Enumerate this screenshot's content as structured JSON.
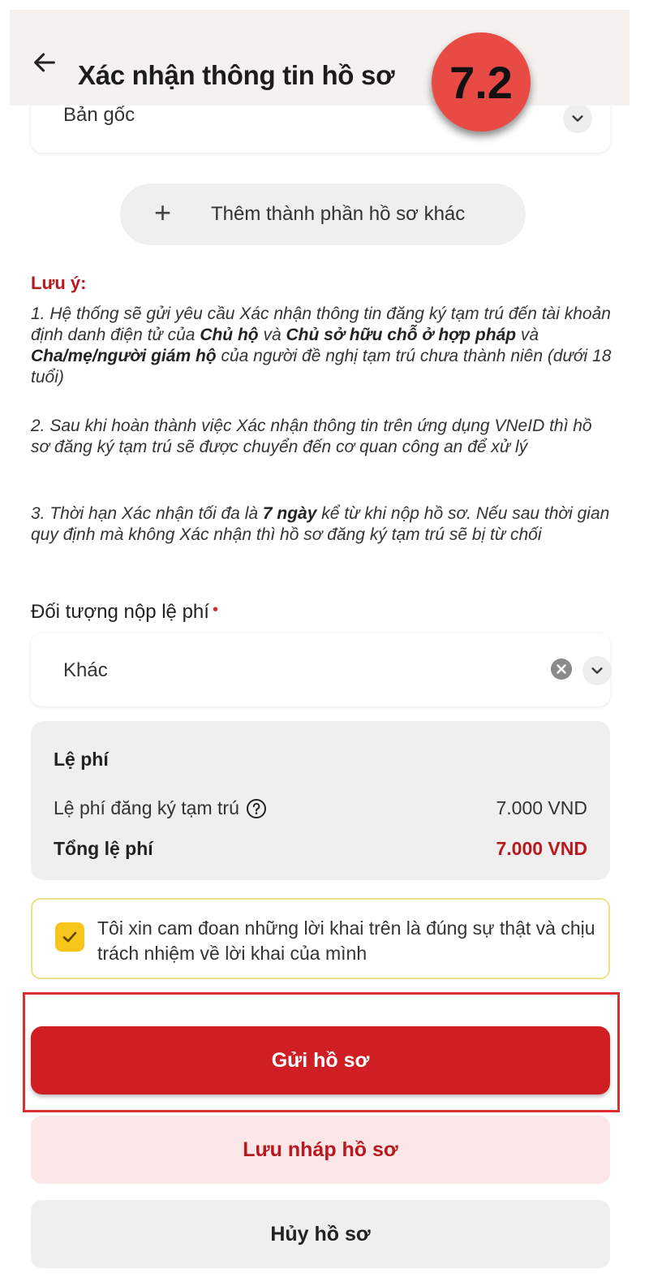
{
  "header": {
    "title": "Xác nhận thông tin hồ sơ",
    "step_badge": "7.2",
    "back_icon": "arrow-left-icon"
  },
  "document_select": {
    "value": "Bản gốc",
    "icon": "chevron-down-icon"
  },
  "add_component": {
    "icon": "plus-icon",
    "label": "Thêm thành phần hồ sơ khác"
  },
  "note": {
    "title": "Lưu ý:",
    "item1": {
      "p1": "1. Hệ thống sẽ gửi yêu cầu Xác nhận thông tin đăng ký tạm trú đến tài khoản định danh điện tử của ",
      "b1": "Chủ hộ",
      "p2": " và ",
      "b2": "Chủ sở hữu chỗ ở hợp pháp",
      "p3": " và ",
      "b3": "Cha/mẹ/người giám hộ",
      "p4": " của người đề nghị tạm trú chưa thành niên (dưới 18 tuổi)"
    },
    "item2": "2. Sau khi hoàn thành việc Xác nhận thông tin trên ứng dụng VNeID thì hồ sơ đăng ký tạm trú sẽ được chuyển đến cơ quan công an để xử lý",
    "item3": {
      "p1": "3. Thời hạn Xác nhận tối đa là ",
      "b1": "7 ngày",
      "p2": " kể từ khi nộp hồ sơ. Nếu sau thời gian quy định mà không Xác nhận thì hồ sơ đăng ký tạm trú sẽ bị từ chối"
    }
  },
  "fee_payer": {
    "label": "Đối tượng nộp lệ phí",
    "required_mark": "•",
    "value": "Khác",
    "clear_icon": "clear-icon",
    "chevron_icon": "chevron-down-icon"
  },
  "fee": {
    "title": "Lệ phí",
    "row_label": "Lệ phí đăng ký tạm trú",
    "row_value": "7.000 VND",
    "total_label": "Tổng lệ phí",
    "total_value": "7.000 VND",
    "help_icon": "help-circle-icon"
  },
  "commitment": {
    "checked": true,
    "text": "Tôi xin cam đoan những lời khai trên là đúng sự thật và chịu trách nhiệm về lời khai của mình"
  },
  "actions": {
    "submit": "Gửi hồ sơ",
    "save_draft": "Lưu nháp hồ sơ",
    "cancel": "Hủy hồ sơ"
  },
  "colors": {
    "primary": "#cf1f25",
    "accent_text": "#b8191f",
    "badge": "#e84a44",
    "checkbox": "#f5c51c"
  }
}
